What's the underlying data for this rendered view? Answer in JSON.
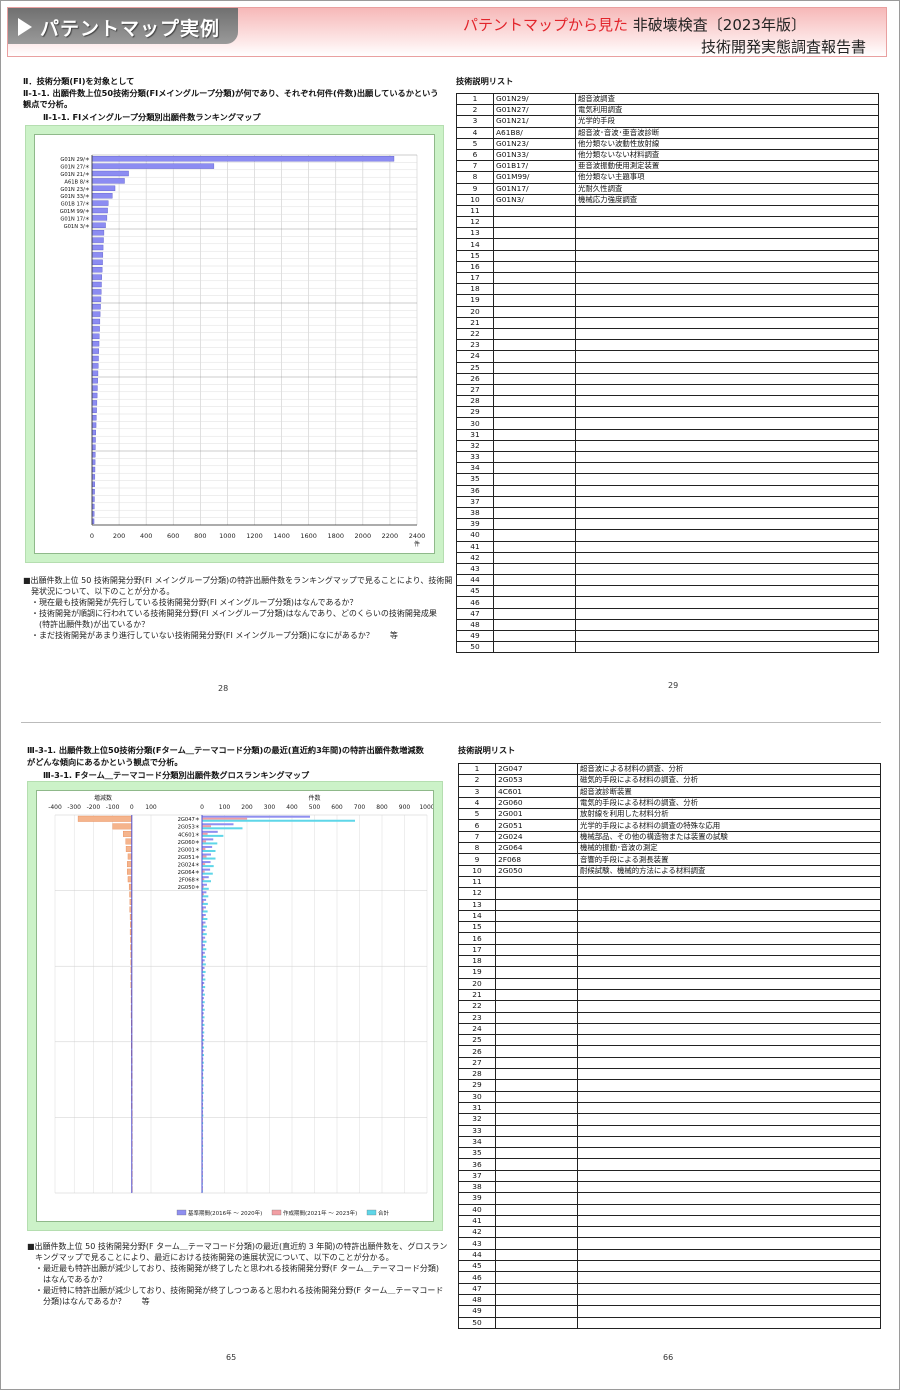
{
  "header": {
    "title": "パテントマップ実例",
    "subtitle_red": "パテントマップから見た",
    "subtitle": "非破壊検査〔2023年版〕",
    "subtitle2": "技術開発実態調査報告書"
  },
  "top_left": {
    "section": "Ⅱ．技術分類(FI)を対象として",
    "heading1": "Ⅱ-1-1. 出願件数上位50技術分類(FIメイングループ分類)が何であり、それぞれ何件(件数)出願しているかという",
    "heading2": "観点で分析。",
    "chart_title": "Ⅱ-1-1. FIメイングループ分類別出願件数ランキングマップ",
    "bullets": [
      "■出願件数上位 50 技術開発分野(FI メイングループ分類)の特許出願件数をランキングマップで見ることにより、技術開",
      "　発状況について、以下のことが分かる。",
      "　・現在最も技術開発が先行している技術開発分野(FI メイングループ分類)はなんであるか？",
      "　・技術開発が順調に行われている技術開発分野(FI メイングループ分類)はなんであり、どのくらいの技術開発成果",
      "　　(特許出願件数)が出ているか？",
      "　・まだ技術開発があまり進行していない技術開発分野(FI メイングループ分類)になにがあるか？　　等"
    ],
    "page": "28"
  },
  "top_right": {
    "list_title": "技術説明リスト",
    "page": "29",
    "rows": [
      [
        "1",
        "G01N29/",
        "超音波調査"
      ],
      [
        "2",
        "G01N27/",
        "電気利用調査"
      ],
      [
        "3",
        "G01N21/",
        "光学的手段"
      ],
      [
        "4",
        "A61B8/",
        "超音波･音波･亜音波診断"
      ],
      [
        "5",
        "G01N23/",
        "他分類ない波動性放射線"
      ],
      [
        "6",
        "G01N33/",
        "他分類ないない材料調査"
      ],
      [
        "7",
        "G01B17/",
        "亜音波振動使用測定装置"
      ],
      [
        "8",
        "G01M99/",
        "他分類ない主題事項"
      ],
      [
        "9",
        "G01N17/",
        "光耐久性調査"
      ],
      [
        "10",
        "G01N3/",
        "機械応力強度調査"
      ],
      [
        "11",
        "",
        ""
      ],
      [
        "12",
        "",
        ""
      ],
      [
        "13",
        "",
        ""
      ],
      [
        "14",
        "",
        ""
      ],
      [
        "15",
        "",
        ""
      ],
      [
        "16",
        "",
        ""
      ],
      [
        "17",
        "",
        ""
      ],
      [
        "18",
        "",
        ""
      ],
      [
        "19",
        "",
        ""
      ],
      [
        "20",
        "",
        ""
      ],
      [
        "21",
        "",
        ""
      ],
      [
        "22",
        "",
        ""
      ],
      [
        "23",
        "",
        ""
      ],
      [
        "24",
        "",
        ""
      ],
      [
        "25",
        "",
        ""
      ],
      [
        "26",
        "",
        ""
      ],
      [
        "27",
        "",
        ""
      ],
      [
        "28",
        "",
        ""
      ],
      [
        "29",
        "",
        ""
      ],
      [
        "30",
        "",
        ""
      ],
      [
        "31",
        "",
        ""
      ],
      [
        "32",
        "",
        ""
      ],
      [
        "33",
        "",
        ""
      ],
      [
        "34",
        "",
        ""
      ],
      [
        "35",
        "",
        ""
      ],
      [
        "36",
        "",
        ""
      ],
      [
        "37",
        "",
        ""
      ],
      [
        "38",
        "",
        ""
      ],
      [
        "39",
        "",
        ""
      ],
      [
        "40",
        "",
        ""
      ],
      [
        "41",
        "",
        ""
      ],
      [
        "42",
        "",
        ""
      ],
      [
        "43",
        "",
        ""
      ],
      [
        "44",
        "",
        ""
      ],
      [
        "45",
        "",
        ""
      ],
      [
        "46",
        "",
        ""
      ],
      [
        "47",
        "",
        ""
      ],
      [
        "48",
        "",
        ""
      ],
      [
        "49",
        "",
        ""
      ],
      [
        "50",
        "",
        ""
      ]
    ]
  },
  "bottom_left": {
    "heading1": "Ⅲ-3-1. 出願件数上位50技術分類(Fターム＿テーマコード分類)の最近(直近約3年間)の特許出願件数増減数",
    "heading2": "がどんな傾向にあるかという観点で分析。",
    "chart_title": "Ⅲ-3-1. Fターム＿テーマコード分類別出願件数グロスランキングマップ",
    "bullets": [
      "■出願件数上位 50 技術開発分野(F ターム＿テーマコード分類)の最近(直近約 3 年間)の特許出願件数を、グロスラン",
      "　キングマップで見ることにより、最近における技術開発の進展状況について、以下のことが分かる。",
      "　・最近最も特許出願が減少しており、技術開発が終了したと思われる技術開発分野(F ターム＿テーマコード分類)",
      "　　はなんであるか？",
      "　・最近特に特許出願が減少しており、技術開発が終了しつつあると思われる技術開発分野(F ターム＿テーマコード",
      "　　分類)はなんであるか？　　等"
    ],
    "page": "65"
  },
  "bottom_right": {
    "list_title": "技術説明リスト",
    "page": "66",
    "rows": [
      [
        "1",
        "2G047",
        "超音波による材料の調査、分析"
      ],
      [
        "2",
        "2G053",
        "磁気的手段による材料の調査、分析"
      ],
      [
        "3",
        "4C601",
        "超音波診断装置"
      ],
      [
        "4",
        "2G060",
        "電気的手段による材料の調査、分析"
      ],
      [
        "5",
        "2G001",
        "放射線を利用した材料分析"
      ],
      [
        "6",
        "2G051",
        "光学的手段による材料の調査の特殊な応用"
      ],
      [
        "7",
        "2G024",
        "機械部品、その他の構造物または装置の試験"
      ],
      [
        "8",
        "2G064",
        "機械的振動･音波の測定"
      ],
      [
        "9",
        "2F068",
        "音響的手段による測長装置"
      ],
      [
        "10",
        "2G050",
        "耐候試験、機械的方法による材料調査"
      ],
      [
        "11",
        "",
        ""
      ],
      [
        "12",
        "",
        ""
      ],
      [
        "13",
        "",
        ""
      ],
      [
        "14",
        "",
        ""
      ],
      [
        "15",
        "",
        ""
      ],
      [
        "16",
        "",
        ""
      ],
      [
        "17",
        "",
        ""
      ],
      [
        "18",
        "",
        ""
      ],
      [
        "19",
        "",
        ""
      ],
      [
        "20",
        "",
        ""
      ],
      [
        "21",
        "",
        ""
      ],
      [
        "22",
        "",
        ""
      ],
      [
        "23",
        "",
        ""
      ],
      [
        "24",
        "",
        ""
      ],
      [
        "25",
        "",
        ""
      ],
      [
        "26",
        "",
        ""
      ],
      [
        "27",
        "",
        ""
      ],
      [
        "28",
        "",
        ""
      ],
      [
        "29",
        "",
        ""
      ],
      [
        "30",
        "",
        ""
      ],
      [
        "31",
        "",
        ""
      ],
      [
        "32",
        "",
        ""
      ],
      [
        "33",
        "",
        ""
      ],
      [
        "34",
        "",
        ""
      ],
      [
        "35",
        "",
        ""
      ],
      [
        "36",
        "",
        ""
      ],
      [
        "37",
        "",
        ""
      ],
      [
        "38",
        "",
        ""
      ],
      [
        "39",
        "",
        ""
      ],
      [
        "40",
        "",
        ""
      ],
      [
        "41",
        "",
        ""
      ],
      [
        "42",
        "",
        ""
      ],
      [
        "43",
        "",
        ""
      ],
      [
        "44",
        "",
        ""
      ],
      [
        "45",
        "",
        ""
      ],
      [
        "46",
        "",
        ""
      ],
      [
        "47",
        "",
        ""
      ],
      [
        "48",
        "",
        ""
      ],
      [
        "49",
        "",
        ""
      ],
      [
        "50",
        "",
        ""
      ]
    ]
  },
  "chart_data": [
    {
      "type": "bar",
      "orientation": "horizontal",
      "categories": [
        "G01N 29/",
        "G01N 27/",
        "G01N 21/",
        "A61B 8/",
        "G01N 23/",
        "G01N 33/",
        "G01B 17/",
        "G01M 99/",
        "G01N 17/",
        "G01N 3/"
      ],
      "values": [
        2230,
        900,
        270,
        240,
        170,
        150,
        120,
        115,
        110,
        100
      ],
      "tail_values": [
        88,
        85,
        82,
        80,
        78,
        75,
        72,
        70,
        68,
        66,
        63,
        60,
        58,
        56,
        54,
        52,
        50,
        48,
        46,
        44,
        42,
        40,
        38,
        36,
        34,
        32,
        30,
        28,
        26,
        25,
        24,
        23,
        22,
        21,
        20,
        19,
        18,
        17,
        16,
        15
      ],
      "x_ticks": [
        "0",
        "200",
        "400",
        "600",
        "800",
        "1000",
        "1200",
        "1400",
        "1600",
        "1800",
        "2000",
        "2200",
        "2400"
      ],
      "xlim": [
        0,
        2400
      ],
      "x_unit": "件",
      "grid": true
    },
    {
      "type": "bar",
      "orientation": "horizontal",
      "categories": [
        "2G047",
        "2G053",
        "4C601",
        "2G060",
        "2G001",
        "2G051",
        "2G024",
        "2G064",
        "2F068",
        "2G050"
      ],
      "series": [
        {
          "name": "基準期間(2016年 ～ 2020年)",
          "color": "#8f8ff0",
          "values": [
            480,
            140,
            70,
            50,
            45,
            40,
            38,
            36,
            30,
            22
          ]
        },
        {
          "name": "作成期間(2021年 ～ 2023年)",
          "color": "#f29fa4",
          "values": [
            200,
            40,
            25,
            18,
            15,
            20,
            14,
            12,
            10,
            8
          ]
        },
        {
          "name": "合計",
          "color": "#5fd6e8",
          "values": [
            680,
            180,
            95,
            68,
            60,
            60,
            52,
            48,
            40,
            30
          ]
        }
      ],
      "delta_values": [
        -280,
        -100,
        -45,
        -32,
        -30,
        -20,
        -24,
        -24,
        -20,
        -14
      ],
      "delta_tail": [
        -12,
        -10,
        -11,
        -9,
        -8,
        -9,
        -7,
        -7,
        -6,
        -6,
        -5,
        -5,
        -5,
        -4,
        -4,
        -4,
        -4,
        -3,
        -3,
        -3,
        -3,
        -3,
        -2,
        -2,
        -2,
        -2,
        -2,
        -2,
        -2,
        -1,
        -1,
        -1,
        -1,
        -1,
        -1,
        -1,
        -1,
        -1,
        -1,
        -1
      ],
      "tail_values": [
        28,
        26,
        25,
        24,
        22,
        21,
        20,
        19,
        18,
        17,
        16,
        15,
        14,
        13,
        12,
        12,
        11,
        11,
        10,
        10,
        9,
        9,
        8,
        8,
        7,
        7,
        7,
        6,
        6,
        6,
        5,
        5,
        5,
        5,
        4,
        4,
        4,
        4,
        3,
        3
      ],
      "delta_ticks": [
        "-400",
        "-300",
        "-200",
        "-100",
        "0",
        "100"
      ],
      "delta_label": "増減数",
      "x_ticks": [
        "0",
        "100",
        "200",
        "300",
        "400",
        "500",
        "600",
        "700",
        "800",
        "900",
        "1000"
      ],
      "x_label": "件数",
      "grid": true
    }
  ]
}
